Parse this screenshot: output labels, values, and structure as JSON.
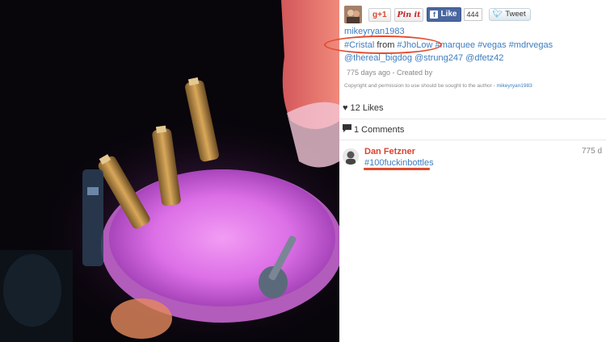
{
  "share": {
    "gplus_label": "g+1",
    "pinit_label": "Pin it",
    "facebook_like_label": "Like",
    "facebook_like_count": "444",
    "tweet_label": "Tweet"
  },
  "post": {
    "author": "mikeyryan1983",
    "caption": {
      "tag1": "#Cristal",
      "word_from": " from ",
      "tag2": "#JhoLow",
      "tag3": "#marquee",
      "tag4": "#vegas",
      "tag5": "#mdrvegas",
      "tag6": "@thereal_bigdog",
      "tag7": "@strung247",
      "tag8": "@dfetz42"
    },
    "meta": "775 days ago - Created by",
    "copyright_text": "Copyright and permission to use should be sought to the author -",
    "copyright_author": "mikeyryan1983"
  },
  "stats": {
    "likes": "12 Likes",
    "comments": "1 Comments"
  },
  "comment": {
    "name": "Dan Fetzner",
    "time": "775 d",
    "text": "#100fuckinbottles"
  },
  "colors": {
    "link": "#3d7dbf",
    "annotation": "#e14a2d",
    "comment_name": "#d9432f"
  }
}
